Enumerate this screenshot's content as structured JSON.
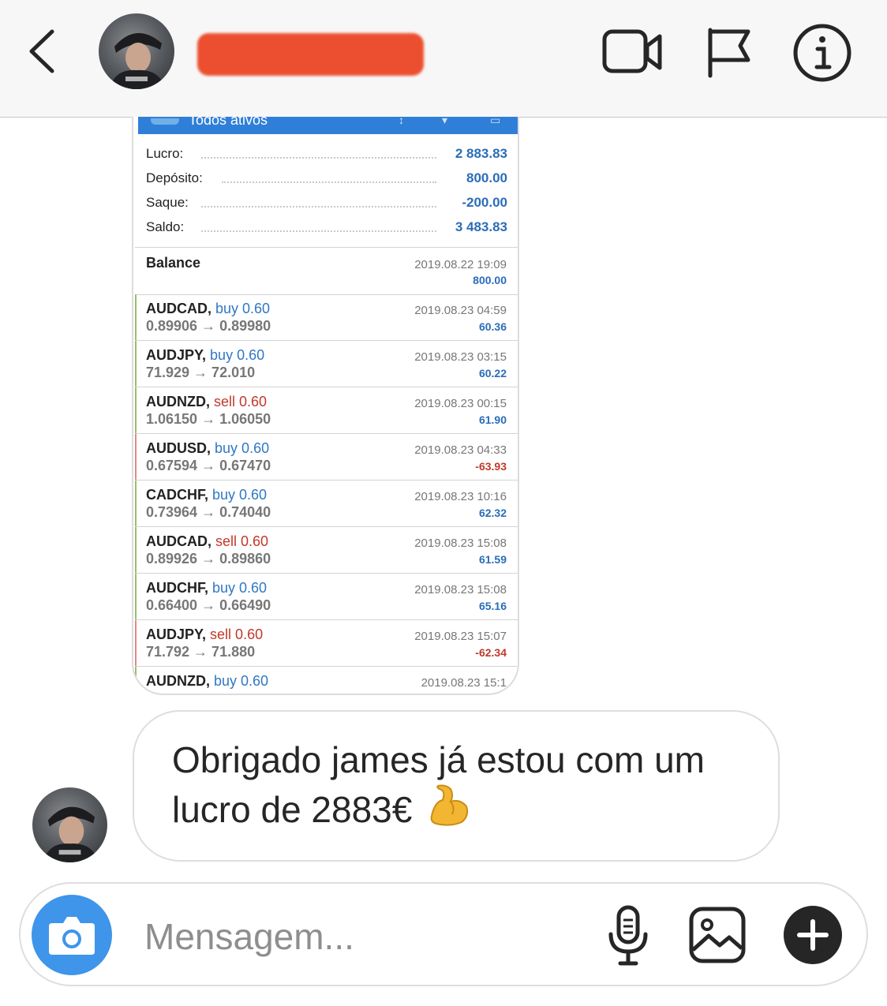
{
  "header": {
    "back_label": "Back",
    "icons": [
      "chevron-left-icon",
      "video-camera-icon",
      "flag-icon",
      "info-icon"
    ]
  },
  "screenshot": {
    "topbar_title": "Todos ativos",
    "summary": [
      {
        "label": "Lucro:",
        "value": "2 883.83"
      },
      {
        "label": "Depósito:",
        "value": "800.00"
      },
      {
        "label": "Saque:",
        "value": "-200.00"
      },
      {
        "label": "Saldo:",
        "value": "3 483.83"
      }
    ],
    "balance": {
      "label": "Balance",
      "date": "2019.08.22 19:09",
      "value": "800.00"
    },
    "trades": [
      {
        "pair": "AUDCAD,",
        "direction": "buy 0.60",
        "prices": "0.89906 → 0.89980",
        "date": "2019.08.23 04:59",
        "profit": "60.36"
      },
      {
        "pair": "AUDJPY,",
        "direction": "buy 0.60",
        "prices": "71.929 → 72.010",
        "date": "2019.08.23 03:15",
        "profit": "60.22"
      },
      {
        "pair": "AUDNZD,",
        "direction": "sell 0.60",
        "prices": "1.06150 → 1.06050",
        "date": "2019.08.23 00:15",
        "profit": "61.90"
      },
      {
        "pair": "AUDUSD,",
        "direction": "buy 0.60",
        "prices": "0.67594 → 0.67470",
        "date": "2019.08.23 04:33",
        "profit": "-63.93"
      },
      {
        "pair": "CADCHF,",
        "direction": "buy 0.60",
        "prices": "0.73964 → 0.74040",
        "date": "2019.08.23 10:16",
        "profit": "62.32"
      },
      {
        "pair": "AUDCAD,",
        "direction": "sell 0.60",
        "prices": "0.89926 → 0.89860",
        "date": "2019.08.23 15:08",
        "profit": "61.59"
      },
      {
        "pair": "AUDCHF,",
        "direction": "buy 0.60",
        "prices": "0.66400 → 0.66490",
        "date": "2019.08.23 15:08",
        "profit": "65.16"
      },
      {
        "pair": "AUDJPY,",
        "direction": "sell 0.60",
        "prices": "71.792 → 71.880",
        "date": "2019.08.23 15:07",
        "profit": "-62.34"
      },
      {
        "pair": "AUDNZD,",
        "direction": "buy 0.60",
        "prices": "",
        "date": "2019.08.23 15:1",
        "profit": ""
      }
    ],
    "colors": {
      "buy": "#2f78c4",
      "sell": "#c0392b",
      "positive": "#2a6db8",
      "negative": "#c0392b",
      "buy_edge": "#9bbf6a",
      "sell_edge": "#e08a8a"
    }
  },
  "message": {
    "text": "Obrigado james já estou com um lucro de 2883€",
    "emoji": "flexed-biceps"
  },
  "composer": {
    "placeholder": "Mensagem...",
    "icons": [
      "camera-icon",
      "microphone-icon",
      "gallery-icon",
      "plus-icon"
    ],
    "camera_color": "#3f95e9"
  }
}
